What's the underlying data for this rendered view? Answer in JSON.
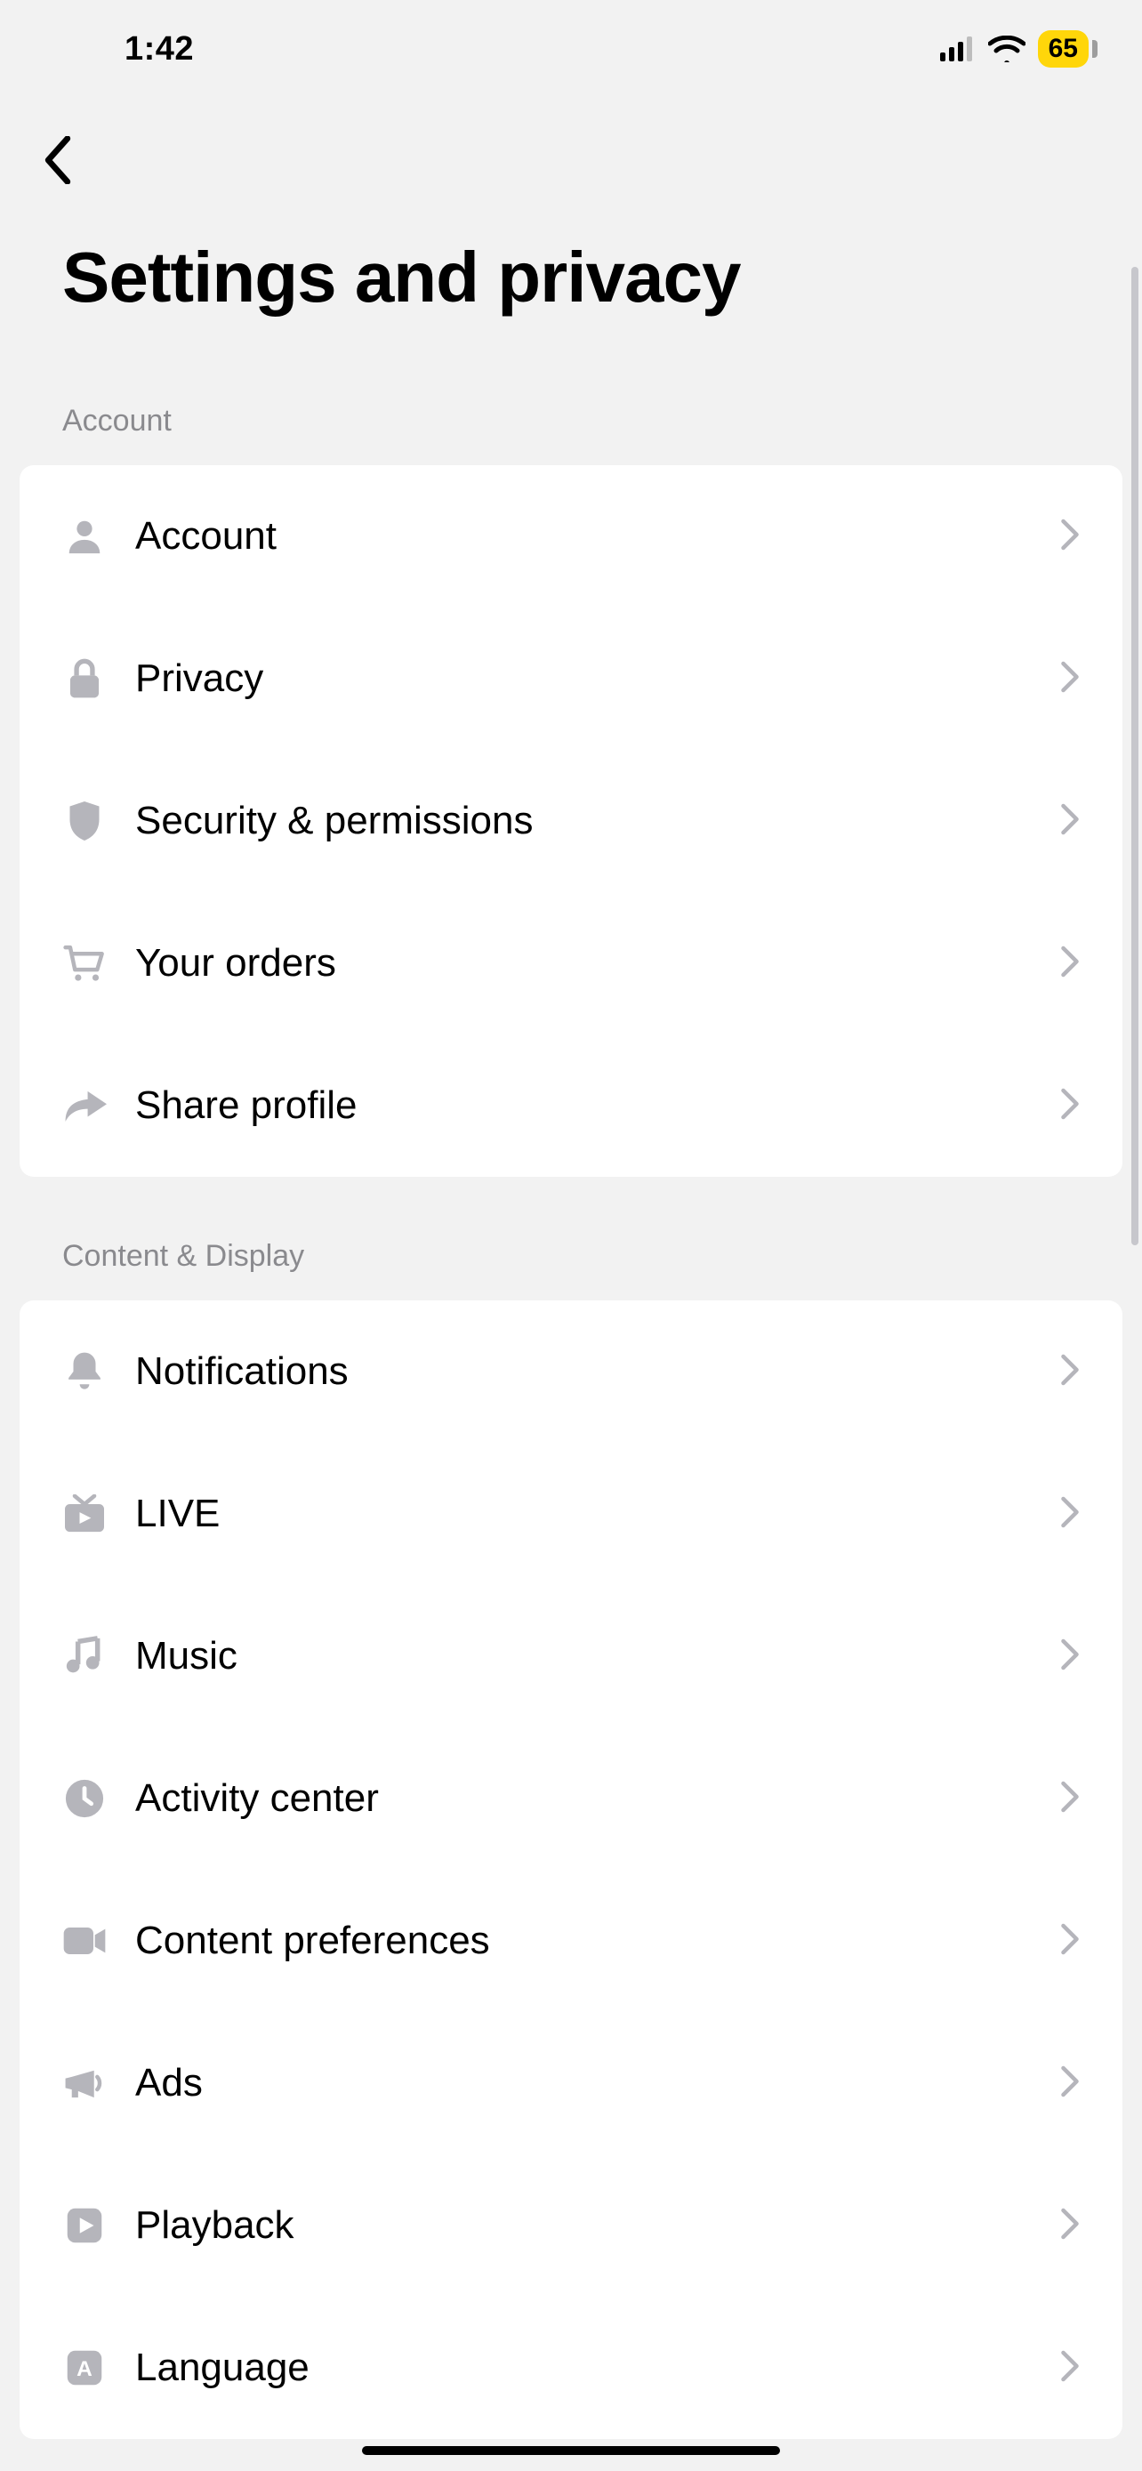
{
  "status": {
    "time": "1:42",
    "battery_percent": "65"
  },
  "header": {
    "title": "Settings and privacy"
  },
  "sections": [
    {
      "header": "Account",
      "items": [
        {
          "icon": "user-icon",
          "label": "Account"
        },
        {
          "icon": "lock-icon",
          "label": "Privacy"
        },
        {
          "icon": "shield-icon",
          "label": "Security & permissions"
        },
        {
          "icon": "cart-icon",
          "label": "Your orders"
        },
        {
          "icon": "share-icon",
          "label": "Share profile"
        }
      ]
    },
    {
      "header": "Content & Display",
      "items": [
        {
          "icon": "bell-icon",
          "label": "Notifications"
        },
        {
          "icon": "tv-icon",
          "label": "LIVE"
        },
        {
          "icon": "music-icon",
          "label": "Music"
        },
        {
          "icon": "clock-icon",
          "label": "Activity center"
        },
        {
          "icon": "video-icon",
          "label": "Content preferences"
        },
        {
          "icon": "megaphone-icon",
          "label": "Ads"
        },
        {
          "icon": "play-square-icon",
          "label": "Playback"
        },
        {
          "icon": "language-icon",
          "label": "Language"
        }
      ]
    }
  ]
}
